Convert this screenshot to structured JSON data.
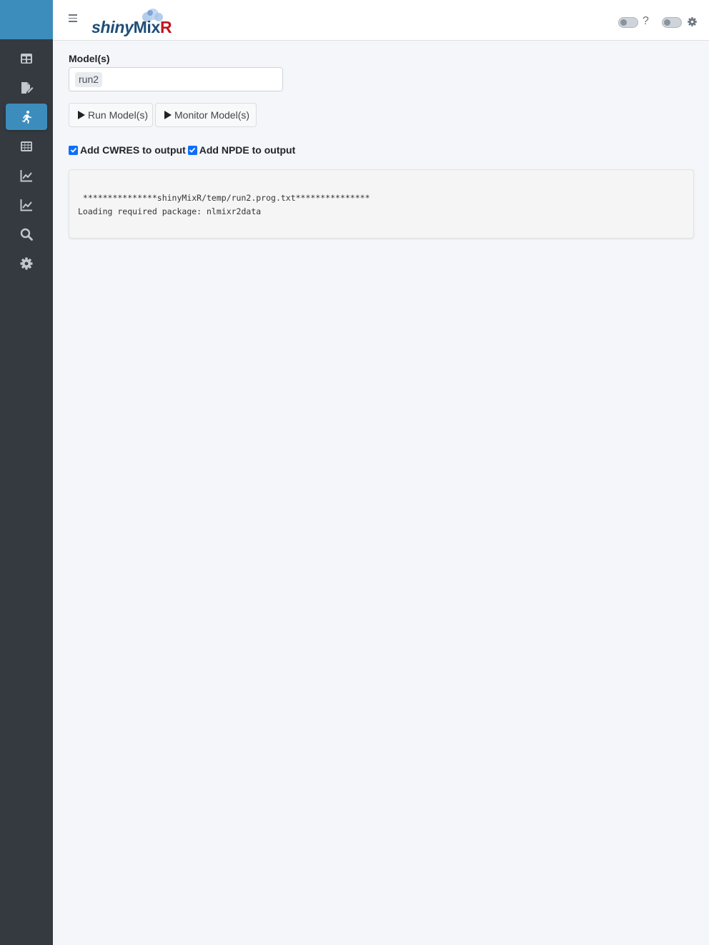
{
  "header": {
    "logo": {
      "part1": "shiny",
      "part2": "Mix",
      "part3": "R"
    },
    "help_icon": "?"
  },
  "sidebar": {
    "items": [
      {
        "icon": "table-icon",
        "active": false
      },
      {
        "icon": "file-edit-icon",
        "active": false
      },
      {
        "icon": "running-icon",
        "active": true
      },
      {
        "icon": "grid-icon",
        "active": false
      },
      {
        "icon": "chart-line-icon",
        "active": false
      },
      {
        "icon": "chart-line-icon",
        "active": false
      },
      {
        "icon": "search-icon",
        "active": false
      },
      {
        "icon": "gear-icon",
        "active": false
      }
    ]
  },
  "main": {
    "model_label": "Model(s)",
    "selected_model": "run2",
    "run_button": "Run Model(s)",
    "monitor_button": "Monitor Model(s)",
    "cwres_label": "Add CWRES to output",
    "npde_label": "Add NPDE to output",
    "cwres_checked": true,
    "npde_checked": true,
    "output_line1": " ***************shinyMixR/temp/run2.prog.txt***************",
    "output_line2": "Loading required package: nlmixr2data"
  },
  "colors": {
    "sidebar_bg": "#343a40",
    "accent": "#3c8dbc",
    "checkbox": "#0d6efd",
    "logo_blue": "#1f4e79",
    "logo_red": "#c0161c"
  }
}
